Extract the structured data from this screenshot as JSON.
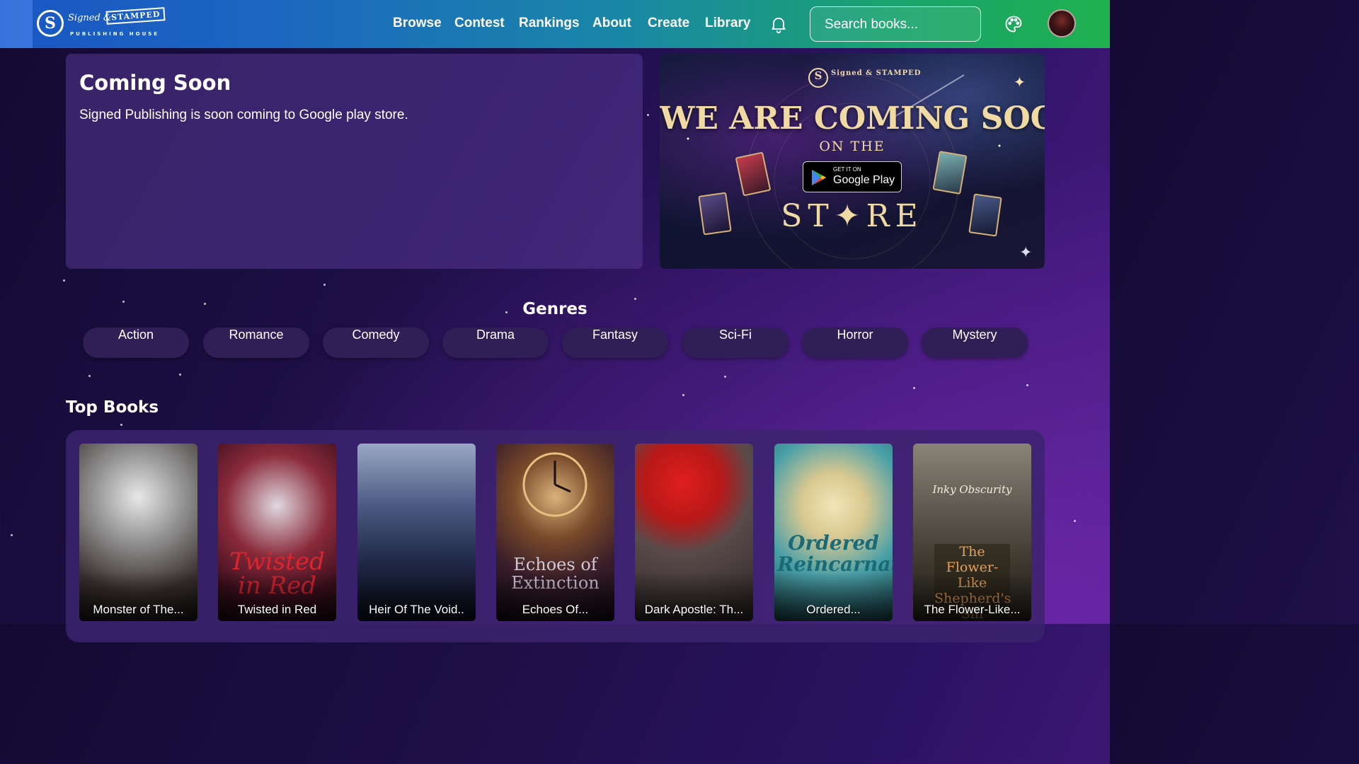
{
  "header": {
    "logo": {
      "mark": "S",
      "script": "Signed",
      "amp": "&",
      "stamp": "STAMPED",
      "subtitle": "PUBLISHING HOUSE"
    },
    "nav": [
      {
        "label": "Browse"
      },
      {
        "label": "Contest"
      },
      {
        "label": "Rankings"
      },
      {
        "label": "About"
      },
      {
        "label": "Create"
      },
      {
        "label": "Library"
      }
    ],
    "search_placeholder": "Search books...",
    "icons": [
      "bell-icon",
      "palette-icon"
    ]
  },
  "announcement": {
    "title": "Coming Soon",
    "text": "Signed Publishing is soon coming to Google play store."
  },
  "banner": {
    "logo_mark": "S",
    "logo_text": "Signed & STAMPED",
    "headline": "WE ARE COMING SOON",
    "on_the": "ON THE",
    "badge_small": "GET IT ON",
    "badge_big": "Google Play",
    "store": "ST✦RE"
  },
  "genres": {
    "title": "Genres",
    "items": [
      "Action",
      "Romance",
      "Comedy",
      "Drama",
      "Fantasy",
      "Sci-Fi",
      "Horror",
      "Mystery"
    ]
  },
  "top_books": {
    "title": "Top Books",
    "items": [
      {
        "title": "Monster of The...",
        "colors": [
          "#d9d9d9",
          "#5a5a5a"
        ]
      },
      {
        "title": "Twisted in Red",
        "colors": [
          "#8a1a2a",
          "#2a0e2a"
        ],
        "cover_text": "Twisted in Red"
      },
      {
        "title": "Heir Of The Void..",
        "colors": [
          "#6b7fa6",
          "#141c33"
        ]
      },
      {
        "title": "Echoes Of...",
        "colors": [
          "#b08040",
          "#1a1020"
        ],
        "cover_text": "Echoes of Extinction"
      },
      {
        "title": "Dark Apostle: Th...",
        "colors": [
          "#c82222",
          "#2a2424"
        ]
      },
      {
        "title": "Ordered...",
        "colors": [
          "#57b0b8",
          "#e8d8a0"
        ],
        "cover_text": "Ordered Reincarnation"
      },
      {
        "title": "The Flower-Like...",
        "colors": [
          "#6a6258",
          "#2b2820"
        ],
        "cover_text": "The Flower-Like Shepherd's Sin",
        "cover_top": "Inky Obscurity"
      }
    ]
  }
}
